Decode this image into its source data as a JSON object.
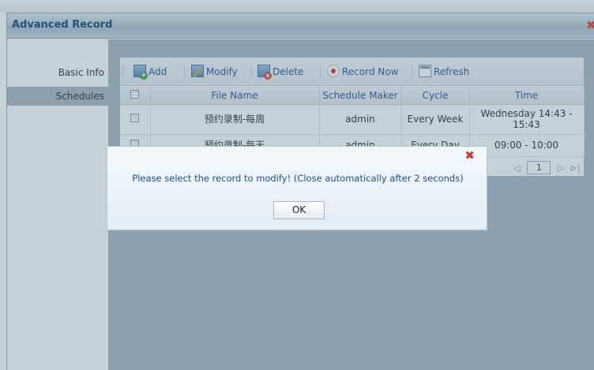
{
  "window": {
    "title": "Advanced Record"
  },
  "sidebar": {
    "items": [
      {
        "label": "Basic Info"
      },
      {
        "label": "Schedules"
      }
    ]
  },
  "toolbar": {
    "add": "Add",
    "modify": "Modify",
    "delete": "Delete",
    "record_now": "Record Now",
    "refresh": "Refresh"
  },
  "table": {
    "headers": [
      "",
      "File Name",
      "Schedule Maker",
      "Cycle",
      "Time"
    ],
    "rows": [
      {
        "file_name": "预约录制-每周",
        "maker": "admin",
        "cycle": "Every Week",
        "time": "Wednesday  14:43 - 15:43"
      },
      {
        "file_name": "预约录制-每天",
        "maker": "admin",
        "cycle": "Every Day",
        "time": "09:00 - 10:00"
      }
    ]
  },
  "pager": {
    "page": "1"
  },
  "dialog": {
    "message": "Please select the record to modify! (Close automatically after 2 seconds)",
    "ok": "OK"
  }
}
